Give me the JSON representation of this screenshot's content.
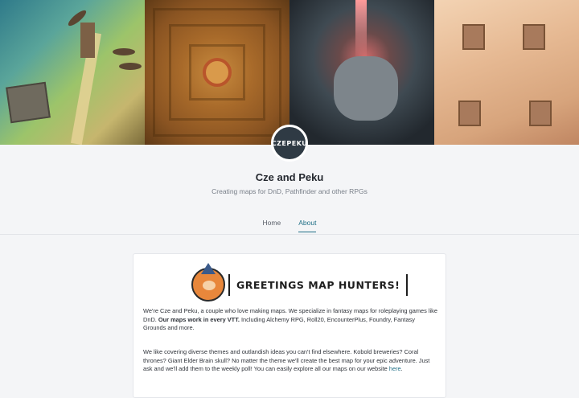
{
  "profile": {
    "name": "Cze and Peku",
    "tagline": "Creating maps for DnD, Pathfinder and other RPGs",
    "avatar_text": "CZEPEKU"
  },
  "tabs": [
    {
      "label": "Home",
      "active": false
    },
    {
      "label": "About",
      "active": true
    }
  ],
  "about": {
    "heading": "GREETINGS MAP HUNTERS!",
    "para1_start": "We're Cze and Peku, a couple who love making maps. We specialize in fantasy maps for roleplaying games like DnD. ",
    "para1_bold": "Our maps work in every VTT.",
    "para1_end": " Including Alchemy RPG, Roll20, EncounterPlus, Foundry, Fantasy Grounds and more.",
    "para2_start": "We like covering diverse themes and outlandish ideas you can't find elsewhere. Kobold breweries? Coral thrones? Giant Elder Brain skull? No matter the theme we'll create the best map for your epic adventure. Just ask and we'll add them to the weekly poll! You can easily explore all our maps on our website ",
    "para2_link": "here",
    "para2_end": "."
  },
  "colors": {
    "accent": "#1f6f86",
    "background": "#f4f5f7"
  },
  "icons": {
    "avatar": "creator-avatar-icon",
    "mascot": "fox-wizard-mascot-icon"
  }
}
